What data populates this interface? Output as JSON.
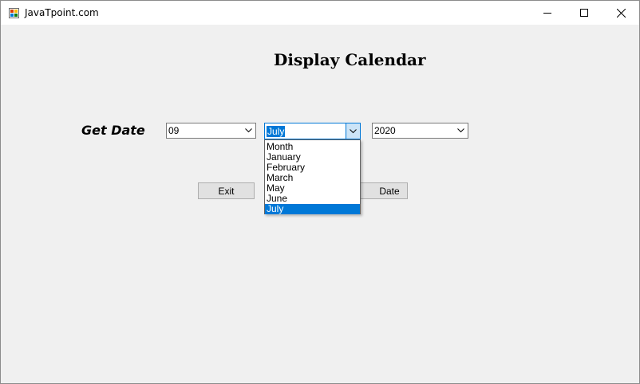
{
  "window": {
    "title": "JavaTpoint.com"
  },
  "form": {
    "heading": "Display Calendar",
    "get_date_label": "Get Date",
    "day_combo": {
      "value": "09"
    },
    "month_combo": {
      "value": "July",
      "options": [
        "Month",
        "January",
        "February",
        "March",
        "May",
        "June",
        "July"
      ],
      "selected_index": 6
    },
    "year_combo": {
      "value": "2020"
    },
    "exit_button": "Exit",
    "date_button": "Date"
  },
  "colors": {
    "selection": "#0078d7",
    "window_bg": "#f0f0f0",
    "button_bg": "#e1e1e1"
  }
}
